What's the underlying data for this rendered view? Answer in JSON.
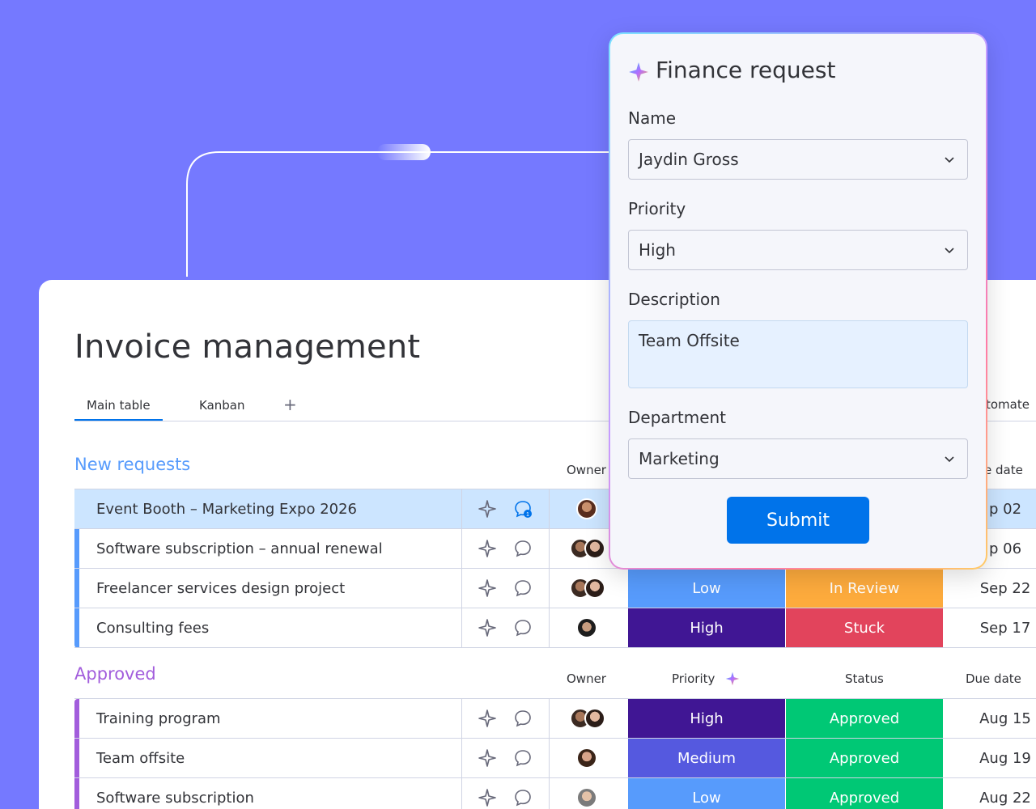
{
  "board": {
    "title": "Invoice management",
    "tabs": [
      "Main table",
      "Kanban"
    ],
    "add_tab": "+",
    "automate_label": "tomate"
  },
  "colors": {
    "background": "#7579ff",
    "primary": "#0073ea",
    "low": "#579bfc",
    "medium": "#5559df",
    "high": "#401694",
    "in_review": "#fdab3d",
    "stuck": "#e2445c",
    "approved": "#00c875",
    "new_requests_group": "#579bfc",
    "approved_group": "#a25ddc"
  },
  "groups": [
    {
      "title": "New requests",
      "headers": {
        "owner": "Owner",
        "due_date": "e date"
      },
      "rows": [
        {
          "name": "Event Booth – Marketing Expo 2026",
          "priority": "",
          "status": "",
          "due": "p 02",
          "owners": 1
        },
        {
          "name": "Software subscription – annual renewal",
          "priority": "",
          "status": "",
          "due": "p 06",
          "owners": 2
        },
        {
          "name": "Freelancer services design project",
          "priority": "Low",
          "status": "In Review",
          "due": "Sep 22",
          "owners": 2
        },
        {
          "name": "Consulting fees",
          "priority": "High",
          "status": "Stuck",
          "due": "Sep 17",
          "owners": 1
        }
      ]
    },
    {
      "title": "Approved",
      "headers": {
        "owner": "Owner",
        "priority": "Priority",
        "status": "Status",
        "due_date": "Due date"
      },
      "rows": [
        {
          "name": "Training program",
          "priority": "High",
          "status": "Approved",
          "due": "Aug 15",
          "owners": 2
        },
        {
          "name": "Team offsite",
          "priority": "Medium",
          "status": "Approved",
          "due": "Aug 19",
          "owners": 1
        },
        {
          "name": "Software subscription",
          "priority": "Low",
          "status": "Approved",
          "due": "Aug 22",
          "owners": 1
        }
      ]
    }
  ],
  "form": {
    "title": "Finance request",
    "name_label": "Name",
    "name_value": "Jaydin Gross",
    "priority_label": "Priority",
    "priority_value": "High",
    "description_label": "Description",
    "description_value": "Team Offsite",
    "department_label": "Department",
    "department_value": "Marketing",
    "submit_label": "Submit"
  }
}
